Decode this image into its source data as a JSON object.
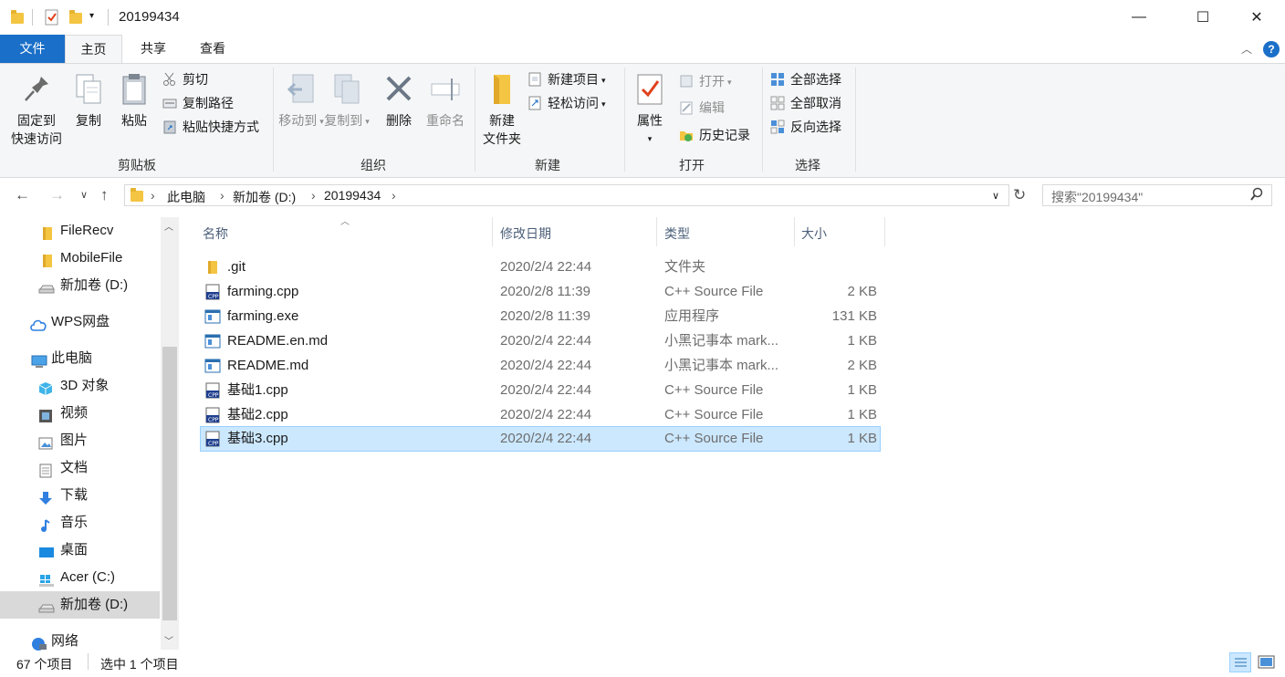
{
  "window": {
    "title": "20199434",
    "controls": {
      "minimize": "—",
      "maximize": "☐",
      "close": "✕"
    }
  },
  "ribbon_tabs": [
    "文件",
    "主页",
    "共享",
    "查看"
  ],
  "ribbon": {
    "clipboard": {
      "label": "剪贴板",
      "pin_line1": "固定到",
      "pin_line2": "快速访问",
      "copy": "复制",
      "paste": "粘贴",
      "cut": "剪切",
      "copy_path": "复制路径",
      "paste_shortcut": "粘贴快捷方式"
    },
    "organize": {
      "label": "组织",
      "move_to": "移动到",
      "copy_to": "复制到",
      "delete": "删除",
      "rename": "重命名"
    },
    "new": {
      "label": "新建",
      "new_folder_line1": "新建",
      "new_folder_line2": "文件夹",
      "new_item": "新建项目",
      "easy_access": "轻松访问"
    },
    "open": {
      "label": "打开",
      "properties": "属性",
      "open": "打开",
      "edit": "编辑",
      "history": "历史记录"
    },
    "select": {
      "label": "选择",
      "select_all": "全部选择",
      "select_none": "全部取消",
      "invert": "反向选择"
    }
  },
  "address": {
    "crumbs": [
      "此电脑",
      "新加卷 (D:)",
      "20199434"
    ],
    "search_placeholder": "搜索\"20199434\""
  },
  "sidebar": {
    "items": [
      {
        "label": "FileRecv",
        "icon": "folder-icon"
      },
      {
        "label": "MobileFile",
        "icon": "folder-icon"
      },
      {
        "label": "新加卷 (D:)",
        "icon": "drive-icon"
      },
      {
        "label": "WPS网盘",
        "icon": "cloud-icon"
      },
      {
        "label": "此电脑",
        "icon": "computer-icon"
      },
      {
        "label": "3D 对象",
        "icon": "cube-icon"
      },
      {
        "label": "视频",
        "icon": "video-icon"
      },
      {
        "label": "图片",
        "icon": "picture-icon"
      },
      {
        "label": "文档",
        "icon": "document-icon"
      },
      {
        "label": "下载",
        "icon": "download-icon"
      },
      {
        "label": "音乐",
        "icon": "music-icon"
      },
      {
        "label": "桌面",
        "icon": "desktop-icon"
      },
      {
        "label": "Acer (C:)",
        "icon": "windows-drive-icon"
      },
      {
        "label": "新加卷 (D:)",
        "icon": "drive-icon"
      },
      {
        "label": "网络",
        "icon": "network-icon"
      }
    ]
  },
  "columns": {
    "name": "名称",
    "date": "修改日期",
    "type": "类型",
    "size": "大小"
  },
  "files": [
    {
      "name": ".git",
      "date": "2020/2/4 22:44",
      "type": "文件夹",
      "size": "",
      "icon": "folder-icon"
    },
    {
      "name": "farming.cpp",
      "date": "2020/2/8 11:39",
      "type": "C++ Source File",
      "size": "2 KB",
      "icon": "cpp-file-icon"
    },
    {
      "name": "farming.exe",
      "date": "2020/2/8 11:39",
      "type": "应用程序",
      "size": "131 KB",
      "icon": "exe-file-icon"
    },
    {
      "name": "README.en.md",
      "date": "2020/2/4 22:44",
      "type": "小黑记事本 mark...",
      "size": "1 KB",
      "icon": "md-file-icon"
    },
    {
      "name": "README.md",
      "date": "2020/2/4 22:44",
      "type": "小黑记事本 mark...",
      "size": "2 KB",
      "icon": "md-file-icon"
    },
    {
      "name": "基础1.cpp",
      "date": "2020/2/4 22:44",
      "type": "C++ Source File",
      "size": "1 KB",
      "icon": "cpp-file-icon"
    },
    {
      "name": "基础2.cpp",
      "date": "2020/2/4 22:44",
      "type": "C++ Source File",
      "size": "1 KB",
      "icon": "cpp-file-icon"
    },
    {
      "name": "基础3.cpp",
      "date": "2020/2/4 22:44",
      "type": "C++ Source File",
      "size": "1 KB",
      "icon": "cpp-file-icon",
      "selected": true
    }
  ],
  "status": {
    "count": "67 个项目",
    "selected": "选中 1 个项目"
  },
  "colors": {
    "accent": "#1a6fc8",
    "selection": "#cce8ff",
    "folder": "#f4c542"
  }
}
